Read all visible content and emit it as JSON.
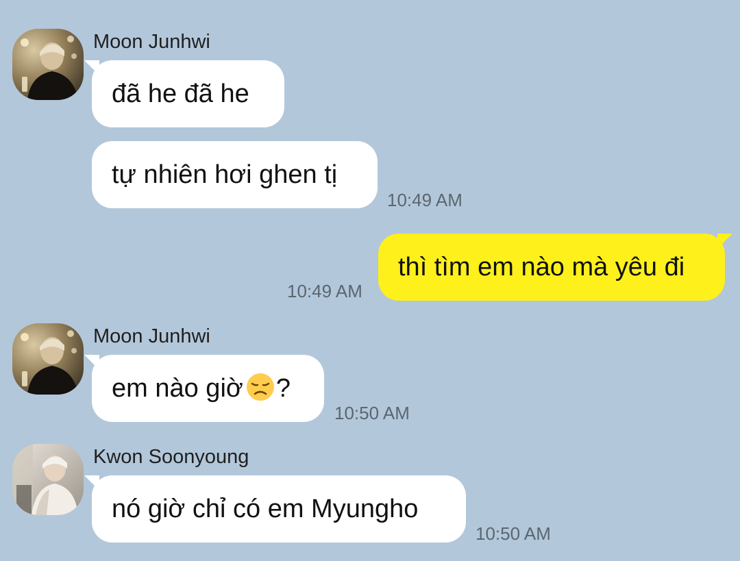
{
  "colors": {
    "background": "#b2c7da",
    "bubble_other": "#ffffff",
    "bubble_mine": "#fef01b",
    "time_text": "#5b6670"
  },
  "messages": [
    {
      "sender": "Moon Junhwi",
      "avatar": "profile-photo-moon-junhwi",
      "bubbles": [
        {
          "text": "đã he đã he"
        },
        {
          "text": "tự nhiên hơi ghen tị",
          "time": "10:49 AM"
        }
      ]
    },
    {
      "sender": "",
      "mine": true,
      "bubbles": [
        {
          "text": "thì tìm em nào mà yêu đi",
          "time": "10:49 AM"
        }
      ]
    },
    {
      "sender": "Moon Junhwi",
      "avatar": "profile-photo-moon-junhwi",
      "bubbles": [
        {
          "text": "em nào giờ",
          "emoji": "disappointed-face-emoji",
          "suffix": "?",
          "time": "10:50 AM"
        }
      ]
    },
    {
      "sender": "Kwon Soonyoung",
      "avatar": "profile-photo-kwon-soonyoung",
      "bubbles": [
        {
          "text": "nó giờ chỉ có em Myungho",
          "time": "10:50 AM"
        }
      ]
    }
  ]
}
